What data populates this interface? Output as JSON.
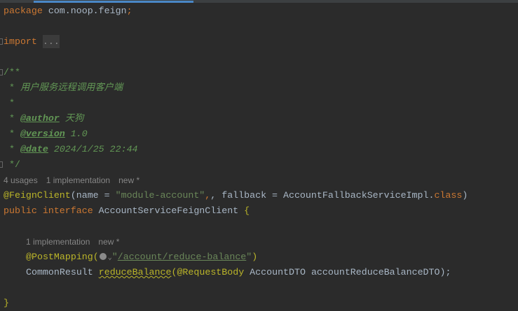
{
  "code": {
    "package_kw": "package",
    "package_name": "com.noop.feign",
    "semi": ";",
    "import_kw": "import",
    "import_fold": "...",
    "doc_open": "/**",
    "doc_star": " * ",
    "doc_desc": "用户服务远程调用客户端",
    "doc_empty": " *",
    "author_tag": "@author",
    "author_val": " 天狗",
    "version_tag": "@version",
    "version_val": " 1.0",
    "date_tag": "@date",
    "date_val": " 2024/1/25 22:44",
    "doc_close": " */",
    "class_inlay": {
      "usages": "4 usages",
      "impl": "1 implementation",
      "author": "new *"
    },
    "feign_ann": "@FeignClient",
    "feign_open": "(name = ",
    "feign_name": "\"module-account\"",
    "feign_mid": ", fallback = AccountFallbackServiceImpl.",
    "feign_class": "class",
    "feign_close": ")",
    "public_kw": "public",
    "interface_kw": " interface",
    "iface_name": " AccountServiceFeignClient ",
    "brace_open": "{",
    "method_inlay": {
      "impl": "1 implementation",
      "author": "new *"
    },
    "post_ann": "@PostMapping(",
    "quote": "\"",
    "post_url": "/account/reduce-balance",
    "post_close": ")",
    "ret_type": "CommonResult ",
    "method_name": "reduceBalance",
    "rb_ann": "(@RequestBody",
    "param": " AccountDTO accountReduceBalanceDTO);",
    "brace_close": "}"
  }
}
